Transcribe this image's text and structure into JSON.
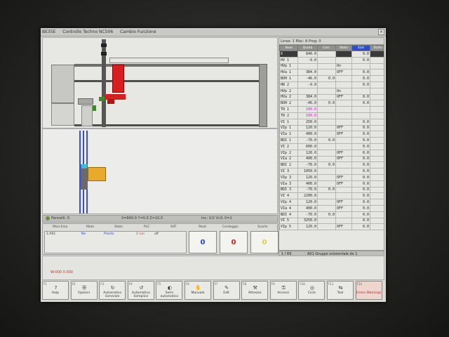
{
  "window": {
    "title_parts": [
      "BE35E",
      "Controllo Techno NC506",
      "Cambio Funzione"
    ],
    "close_glyph": "×"
  },
  "right_panel": {
    "header": "Linea: 1  Mac: A  Prog: 0",
    "columns": [
      "Asse",
      "Quota",
      "Corr.",
      "Stato",
      "Size",
      "Stato"
    ],
    "rows": [
      {
        "name": "X",
        "quota": "840.0",
        "corr": "",
        "stato": "",
        "size": "0.0"
      },
      {
        "name": "HV 1",
        "quota": "-9.0",
        "corr": "",
        "stato": "",
        "size": "0.0"
      },
      {
        "name": "HVp 1",
        "quota": "",
        "corr": "",
        "stato": "On",
        "size": ""
      },
      {
        "name": "HVa 1",
        "quota": "384.0",
        "corr": "",
        "stato": "OFF",
        "size": "0.0"
      },
      {
        "name": "BOH 1",
        "quota": "-46.0",
        "corr": "0.0",
        "stato": "",
        "size": "0.0"
      },
      {
        "name": "HR 2",
        "quota": "-9.0",
        "corr": "",
        "stato": "",
        "size": "0.0"
      },
      {
        "name": "HVp 2",
        "quota": "",
        "corr": "",
        "stato": "On",
        "size": ""
      },
      {
        "name": "HVa 2",
        "quota": "384.0",
        "corr": "",
        "stato": "OFF",
        "size": "0.0"
      },
      {
        "name": "BOH 2",
        "quota": "-46.0",
        "corr": "0.0",
        "stato": "",
        "size": "0.0"
      },
      {
        "name": "TR 1",
        "quota": "100.0",
        "corr": "",
        "stato": "",
        "size": "",
        "magenta": true
      },
      {
        "name": "TR 2",
        "quota": "100.0",
        "corr": "",
        "stato": "",
        "size": "",
        "magenta": true
      },
      {
        "name": "VI 1",
        "quota": "250.0",
        "corr": "",
        "stato": "",
        "size": "0.0"
      },
      {
        "name": "VIp 1",
        "quota": "120.0",
        "corr": "",
        "stato": "OFF",
        "size": "0.0"
      },
      {
        "name": "VIa 1",
        "quota": "400.0",
        "corr": "",
        "stato": "OFF",
        "size": "0.0"
      },
      {
        "name": "BDI 1",
        "quota": "-70.0",
        "corr": "0.0",
        "stato": "",
        "size": "0.0"
      },
      {
        "name": "VI 2",
        "quota": "600.0",
        "corr": "",
        "stato": "",
        "size": "0.0"
      },
      {
        "name": "VIp 2",
        "quota": "120.0",
        "corr": "",
        "stato": "OFF",
        "size": "0.0"
      },
      {
        "name": "VIa 2",
        "quota": "400.0",
        "corr": "",
        "stato": "OFF",
        "size": "0.0"
      },
      {
        "name": "BDI 2",
        "quota": "-70.0",
        "corr": "0.0",
        "stato": "",
        "size": "0.0"
      },
      {
        "name": "VI 3",
        "quota": "1050.0",
        "corr": "",
        "stato": "",
        "size": "0.0"
      },
      {
        "name": "VIp 3",
        "quota": "120.0",
        "corr": "",
        "stato": "OFF",
        "size": "0.0"
      },
      {
        "name": "VIa 3",
        "quota": "400.0",
        "corr": "",
        "stato": "OFF",
        "size": "0.0"
      },
      {
        "name": "BDI 3",
        "quota": "-70.0",
        "corr": "0.0",
        "stato": "",
        "size": "0.0"
      },
      {
        "name": "VI 4",
        "quota": "2200.0",
        "corr": "",
        "stato": "",
        "size": "0.0"
      },
      {
        "name": "VIp 4",
        "quota": "120.0",
        "corr": "",
        "stato": "OFF",
        "size": "0.0"
      },
      {
        "name": "VIa 4",
        "quota": "400.0",
        "corr": "",
        "stato": "OFF",
        "size": "0.0"
      },
      {
        "name": "BDI 4",
        "quota": "-70.0",
        "corr": "0.0",
        "stato": "",
        "size": "0.0"
      },
      {
        "name": "VI 5",
        "quota": "3250.0",
        "corr": "",
        "stato": "",
        "size": "0.0"
      },
      {
        "name": "VIp 5",
        "quota": "120.0",
        "corr": "",
        "stato": "OFF",
        "size": "0.0"
      }
    ],
    "footer_page": "1 / 69",
    "footer_text": "A01 Gruppo orizzontale dx 1"
  },
  "status_strip": {
    "left": "Pannelli: 0",
    "mid": "X=840.0  Y=0.0  Z=10.0",
    "right": "Inc: V/2  Vc3: 0=1"
  },
  "machine_panel": {
    "headers": [
      "Macchina",
      "Moto",
      "Stato",
      "PLC",
      "SAT",
      "Pezzi",
      "Conteggio",
      "Scarto"
    ],
    "row": {
      "macchina": "1:A01",
      "moto": "No",
      "stato": "Pronto",
      "plc": "1 run",
      "plc_extra": "off"
    },
    "counters": {
      "pezzi": "0",
      "conteggio": "0",
      "scarto": "0"
    },
    "counter_colors": {
      "pezzi": "#2146c9",
      "conteggio": "#d21f1f",
      "scarto": "#d8cf3c"
    }
  },
  "alarm": "W-000  0.000",
  "fkeys": [
    {
      "fn": "F1",
      "label": "Help",
      "icon": "help-icon",
      "glyph": "?"
    },
    {
      "fn": "F2",
      "label": "Opzioni",
      "icon": "options-icon",
      "glyph": "☰"
    },
    {
      "fn": "F3",
      "label": "Automatico Generale",
      "icon": "auto-general-icon",
      "glyph": "↻"
    },
    {
      "fn": "F4",
      "label": "Automatico Semplice",
      "icon": "auto-simple-icon",
      "glyph": "↺"
    },
    {
      "fn": "F5",
      "label": "Semi automatico",
      "icon": "semi-auto-icon",
      "glyph": "◐"
    },
    {
      "fn": "F6",
      "label": "Manuale",
      "icon": "manual-icon",
      "glyph": "✋"
    },
    {
      "fn": "F7",
      "label": "Edit",
      "icon": "edit-icon",
      "glyph": "✎"
    },
    {
      "fn": "F8",
      "label": "Attrezzo",
      "icon": "tool-icon",
      "glyph": "⚒"
    },
    {
      "fn": "F9",
      "label": "Accessi",
      "icon": "access-icon",
      "glyph": "⚿"
    },
    {
      "fn": "F10",
      "label": "Ciclo",
      "icon": "cycle-icon",
      "glyph": "◎"
    },
    {
      "fn": "F11",
      "label": "Tool",
      "icon": "tool-change-icon",
      "glyph": "⇆"
    },
    {
      "fn": "F12",
      "label": "Errors Warnings",
      "icon": "warnings-icon",
      "glyph": "",
      "red": true
    }
  ],
  "colors": {
    "highlight_header": "#2d4bd6",
    "active_part": "#d62020",
    "guide_blue": "#3a4ed8",
    "part_orange": "#e8a92d",
    "magenta_text": "#c21dc2"
  }
}
